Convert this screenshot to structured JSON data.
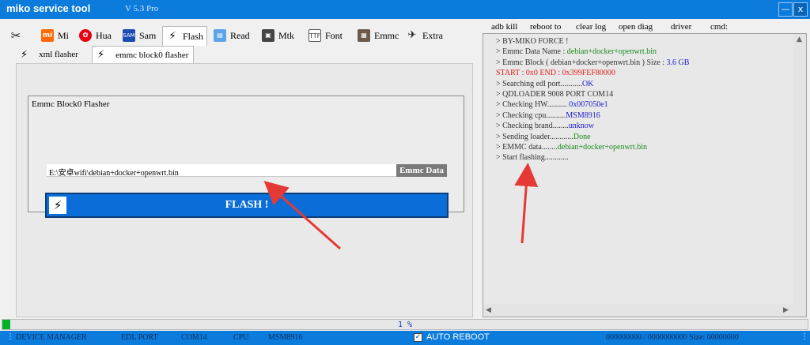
{
  "window": {
    "title": "miko service tool",
    "version": "V 5.3 Pro",
    "minimize_glyph": "—",
    "close_glyph": "x"
  },
  "tabs": [
    {
      "icon": "tools-icon",
      "label": ""
    },
    {
      "icon": "mi-icon",
      "label": "Mi"
    },
    {
      "icon": "huawei-icon",
      "label": "Hua"
    },
    {
      "icon": "samsung-icon",
      "label": "Sam"
    },
    {
      "icon": "flash-icon",
      "label": "Flash"
    },
    {
      "icon": "read-icon",
      "label": "Read"
    },
    {
      "icon": "mtk-icon",
      "label": "Mtk"
    },
    {
      "icon": "font-icon",
      "label": "Font"
    },
    {
      "icon": "emmc-icon",
      "label": "Emmc"
    },
    {
      "icon": "extra-icon",
      "label": "Extra"
    }
  ],
  "active_tab": "Flash",
  "subtabs": [
    {
      "icon": "bolt-icon",
      "label": "xml flasher"
    },
    {
      "icon": "bolt-icon",
      "label": "emmc block0 flasher"
    }
  ],
  "active_subtab": "emmc block0 flasher",
  "panel": {
    "group_title": "Emmc Block0 Flasher",
    "file_path": "E:\\安卓wifi\\debian+docker+openwrt.bin",
    "emmc_data_label": "Emmc Data",
    "flash_label": "FLASH !"
  },
  "right_menu": [
    "adb kill",
    "reboot to",
    "clear log",
    "open diag",
    "driver",
    "cmd:"
  ],
  "log": [
    {
      "text": "> BY-MIKO FORCE !",
      "color": "#333333"
    },
    {
      "parts": [
        {
          "t": "> Emmc Data Name :  ",
          "c": "#333333"
        },
        {
          "t": "debian+docker+openwrt.bin",
          "c": "#1a8a1a"
        }
      ]
    },
    {
      "parts": [
        {
          "t": "> Emmc Block ( debian+docker+openwrt.bin ) Size  :   ",
          "c": "#333333"
        },
        {
          "t": "3.6 GB",
          "c": "#2020d0"
        }
      ]
    },
    {
      "text": "  START  :  0x0    END :   0x399FEF80000",
      "color": "#e02020"
    },
    {
      "parts": [
        {
          "t": "> Searching edl port...........",
          "c": "#333333"
        },
        {
          "t": "OK",
          "c": "#2020d0"
        }
      ]
    },
    {
      "text": "> QDLOADER 9008 PORT COM14",
      "color": "#333333"
    },
    {
      "parts": [
        {
          "t": "> Checking HW..........  ",
          "c": "#333333"
        },
        {
          "t": "0x007050e1",
          "c": "#2020d0"
        }
      ]
    },
    {
      "parts": [
        {
          "t": "> Checking cpu..........",
          "c": "#333333"
        },
        {
          "t": "MSM8916",
          "c": "#2020d0"
        }
      ]
    },
    {
      "parts": [
        {
          "t": "> Checking brand........",
          "c": "#333333"
        },
        {
          "t": "unknow",
          "c": "#2020d0"
        }
      ]
    },
    {
      "parts": [
        {
          "t": "> Sending loader............",
          "c": "#333333"
        },
        {
          "t": "Done",
          "c": "#1a8a1a"
        }
      ]
    },
    {
      "parts": [
        {
          "t": "> EMMC data........",
          "c": "#333333"
        },
        {
          "t": "debian+docker+openwrt.bin",
          "c": "#1a8a1a"
        }
      ]
    },
    {
      "text": "> Start flashing............",
      "color": "#333333"
    }
  ],
  "progress": {
    "percent": 1,
    "label": "1 %"
  },
  "status": {
    "device_manager": "DEVICE MANAGER",
    "edl_port_label": "EDL PORT",
    "edl_port_value": "COM14",
    "cpu_label": "CPU",
    "cpu_value": "MSM8916",
    "auto_reboot_label": "AUTO REBOOT",
    "auto_reboot_checked": true,
    "counter": "000000000  /  0000000000  Size:  00000000"
  },
  "colors": {
    "titlebar": "#0b7bdc",
    "flash_button": "#0b6ed8",
    "progress": "#06b025",
    "arrow": "#e53935"
  }
}
